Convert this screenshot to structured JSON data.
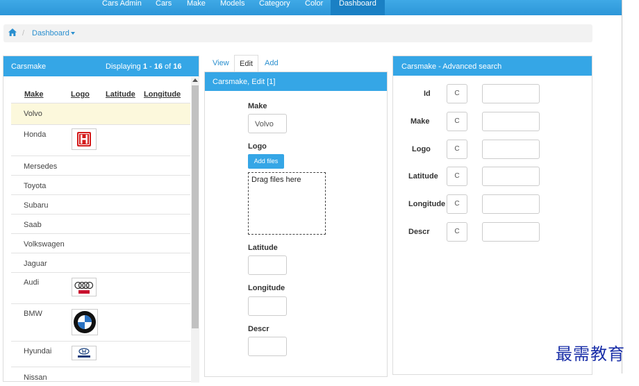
{
  "nav": {
    "items": [
      "Cars Admin",
      "Cars",
      "Make",
      "Models",
      "Category",
      "Color",
      "Dashboard"
    ],
    "active": "Dashboard"
  },
  "breadcrumb": {
    "current": "Dashboard"
  },
  "list": {
    "title": "Carsmake",
    "count_prefix": "Displaying ",
    "count_from": "1",
    "count_mid": " - ",
    "count_to": "16",
    "count_of": " of ",
    "count_total": "16",
    "columns": [
      "Make",
      "Logo",
      "Latitude",
      "Longitude"
    ],
    "rows": [
      "Volvo",
      "Honda",
      "Mersedes",
      "Toyota",
      "Subaru",
      "Saab",
      "Volkswagen",
      "Jaguar",
      "Audi",
      "BMW",
      "Hyundai",
      "Nissan"
    ],
    "selected": "Volvo"
  },
  "edit": {
    "tabs": [
      "View",
      "Edit",
      "Add"
    ],
    "active_tab": "Edit",
    "title": "Carsmake, Edit [1]",
    "make_label": "Make",
    "make_value": "Volvo",
    "logo_label": "Logo",
    "add_files": "Add files",
    "dropzone": "Drag files here",
    "latitude_label": "Latitude",
    "longitude_label": "Longitude",
    "descr_label": "Descr"
  },
  "search": {
    "title": "Carsmake - Advanced search",
    "fields": [
      "Id",
      "Make",
      "Logo",
      "Latitude",
      "Longitude",
      "Descr"
    ],
    "button_label": "C"
  },
  "watermark": "最需教育",
  "colors": {
    "accent": "#35a6e6",
    "selected_row": "#fcf8dc"
  }
}
